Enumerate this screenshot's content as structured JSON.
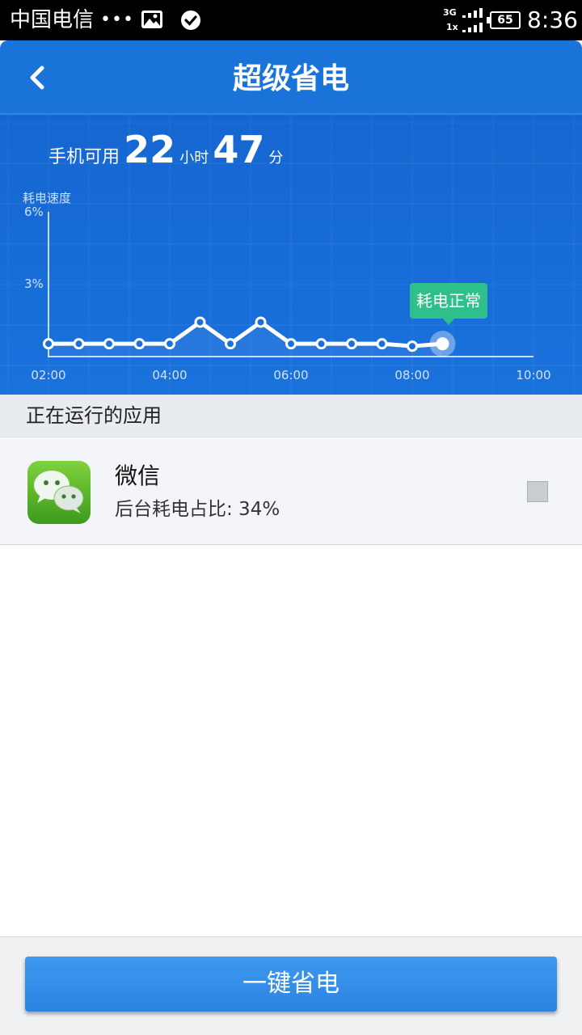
{
  "status_bar": {
    "carrier": "中国电信",
    "dots": "•••",
    "net_top": "3G",
    "net_bottom": "1x",
    "battery": "65",
    "time": "8:36"
  },
  "header": {
    "title": "超级省电",
    "back_icon": "chevron-left-icon"
  },
  "battery_estimate": {
    "label": "手机可用",
    "hours": "22",
    "hours_unit": "小时",
    "minutes": "47",
    "minutes_unit": "分"
  },
  "chart_data": {
    "type": "line",
    "ylabel": "耗电速度",
    "y_ticks": [
      "6%",
      "3%"
    ],
    "ylim": [
      0,
      6
    ],
    "x_ticks": [
      "02:00",
      "04:00",
      "06:00",
      "08:00",
      "10:00"
    ],
    "xlim": [
      "02:00",
      "10:00"
    ],
    "x": [
      "02:00",
      "02:30",
      "03:00",
      "03:30",
      "04:00",
      "04:30",
      "05:00",
      "05:30",
      "06:00",
      "06:30",
      "07:00",
      "07:30",
      "08:00",
      "08:30"
    ],
    "values": [
      0.5,
      0.5,
      0.5,
      0.5,
      0.5,
      1.4,
      0.5,
      1.4,
      0.5,
      0.5,
      0.5,
      0.5,
      0.4,
      0.5
    ],
    "tooltip": "耗电正常",
    "grid": true,
    "colors": {
      "line": "#ffffff",
      "background": "#1a6fd9",
      "tooltip": "#2fbf8a"
    }
  },
  "running_apps": {
    "section_title": "正在运行的应用",
    "items": [
      {
        "name": "微信",
        "usage": "后台耗电占比: 34%",
        "icon": "wechat-icon",
        "checked": false
      }
    ]
  },
  "footer": {
    "button_label": "一键省电"
  }
}
